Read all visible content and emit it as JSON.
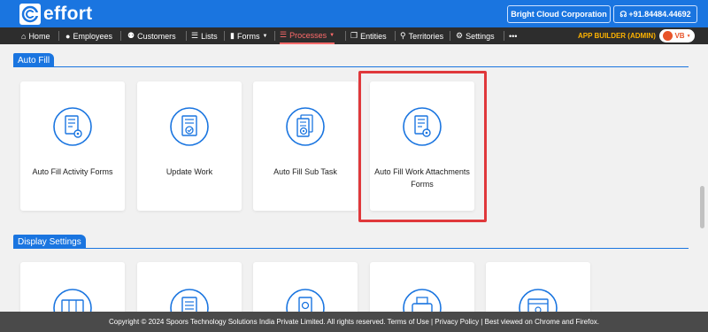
{
  "app": {
    "logo_text": "effort"
  },
  "header": {
    "company": "Bright Cloud Corporation",
    "phone": "+91.84484.44692"
  },
  "nav": {
    "items": [
      {
        "label": "Home",
        "icon": "home-icon"
      },
      {
        "label": "Employees",
        "icon": "user-icon"
      },
      {
        "label": "Customers",
        "icon": "group-icon"
      },
      {
        "label": "Lists",
        "icon": "list-icon"
      },
      {
        "label": "Forms",
        "icon": "file-icon"
      },
      {
        "label": "Processes",
        "icon": "process-icon",
        "active": true
      },
      {
        "label": "Entities",
        "icon": "copy-icon"
      },
      {
        "label": "Territories",
        "icon": "pin-icon"
      },
      {
        "label": "Settings",
        "icon": "gears-icon"
      }
    ],
    "more_label": "•••",
    "app_builder": "APP BUILDER (ADMIN)",
    "user_initials": "VB"
  },
  "sections": [
    {
      "title": "Auto Fill",
      "cards": [
        {
          "label": "Auto Fill Activity Forms",
          "icon": "form-gear-icon"
        },
        {
          "label": "Update Work",
          "icon": "document-check-icon"
        },
        {
          "label": "Auto Fill Sub Task",
          "icon": "documents-gear-icon"
        },
        {
          "label": "Auto Fill Work Attachments Forms",
          "icon": "attachment-gear-icon"
        }
      ]
    },
    {
      "title": "Display Settings",
      "cards": [
        {
          "label": "",
          "icon": "columns-icon"
        },
        {
          "label": "",
          "icon": "form-list-icon"
        },
        {
          "label": "",
          "icon": "document-settings-icon"
        },
        {
          "label": "",
          "icon": "printer-icon"
        },
        {
          "label": "",
          "icon": "browser-settings-icon"
        }
      ]
    }
  ],
  "footer": {
    "text": "Copyright © 2024 Spoors Technology Solutions India Private Limited. All rights reserved. Terms of Use | Privacy Policy | Best viewed on Chrome and Firefox."
  },
  "colors": {
    "brand": "#1a75e0",
    "nav_bg": "#2d2d2d",
    "active": "#ff6b6b",
    "highlight": "#e0383b"
  }
}
